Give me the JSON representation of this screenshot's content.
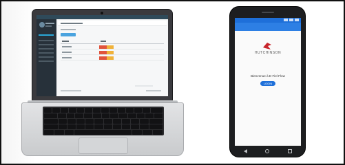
{
  "phone_app": {
    "brand": "HUTCHINSON",
    "welcome_text": "Bienvenue à E-Fiel Flow",
    "login_label": "LOGIN",
    "brand_color": "#c8262c",
    "accent_color": "#1e6fd9"
  },
  "laptop_app": {
    "accent_color": "#4aa3df",
    "status_colors": [
      "#e1533c",
      "#f0b23a"
    ],
    "rows": 3
  },
  "phone_nav": {
    "icons": [
      "back-icon",
      "home-icon",
      "recent-apps-icon"
    ]
  }
}
